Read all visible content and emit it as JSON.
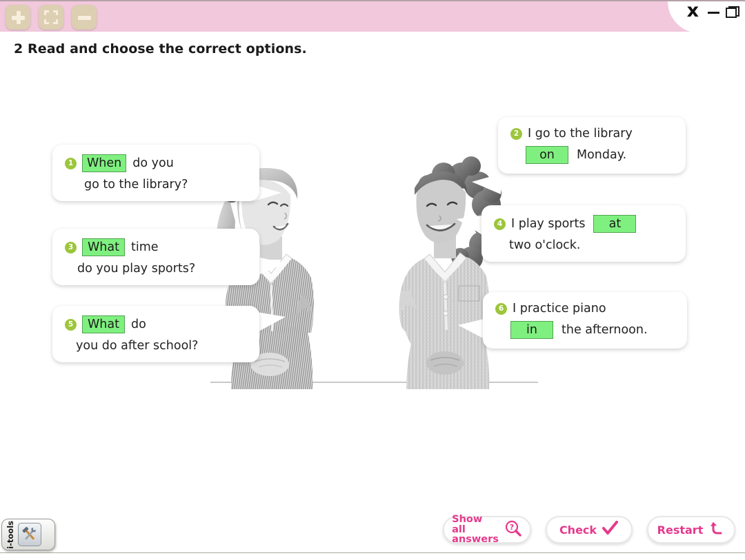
{
  "topbar": {
    "buttons": [
      {
        "name": "zoom-in",
        "icon": "plus-icon"
      },
      {
        "name": "fit-screen",
        "icon": "fit-screen-icon"
      },
      {
        "name": "zoom-out",
        "icon": "minus-icon"
      }
    ],
    "background_color": "#f2c8dc"
  },
  "window_controls": {
    "close_label": "x",
    "minimize_icon": "minimize-icon",
    "restore_icon": "restore-icon"
  },
  "exercise": {
    "heading": "2 Read and choose the correct options.",
    "left_bubbles": [
      {
        "number": "1",
        "line1_pre": "",
        "answer": "When",
        "line1_post": "do you",
        "line2": "go to the library?"
      },
      {
        "number": "3",
        "line1_pre": "",
        "answer": "What",
        "line1_post": "time",
        "line2": "do you play sports?"
      },
      {
        "number": "5",
        "line1_pre": "",
        "answer": "What",
        "line1_post": "do",
        "line2": "you do after school?"
      }
    ],
    "right_bubbles": [
      {
        "number": "2",
        "line1": "I go to the library",
        "answer": "on",
        "line2_post": "Monday."
      },
      {
        "number": "4",
        "line1": "I play sports",
        "answer": "at",
        "line2_post": "two o'clock."
      },
      {
        "number": "6",
        "line1": "I practice piano",
        "answer": "in",
        "line2_post": "the afternoon."
      }
    ],
    "answer_color": "#7ff07f",
    "badge_color": "#9cc63b"
  },
  "photo": {
    "alt": "Two schoolgirls in uniform sitting on a bench talking, black and white"
  },
  "itools": {
    "label": "i-tools",
    "icon": "tools-icon"
  },
  "actions": {
    "show_all": {
      "label": "Show all\nanswers",
      "icon": "magnifier-question-icon"
    },
    "check": {
      "label": "Check",
      "icon": "checkmark-icon"
    },
    "restart": {
      "label": "Restart",
      "icon": "undo-arrow-icon"
    },
    "accent_color": "#e5398c"
  }
}
